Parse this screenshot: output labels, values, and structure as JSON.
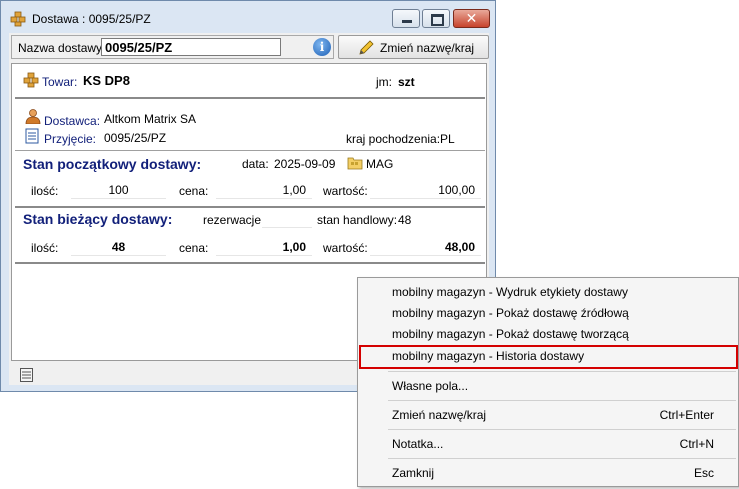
{
  "window": {
    "title": "Dostawa : 0095/25/PZ",
    "close_glyph": "✕"
  },
  "namebar": {
    "label": "Nazwa dostawy:",
    "value": "0095/25/PZ",
    "info_glyph": "i",
    "rename_button": "Zmień nazwę/kraj"
  },
  "product": {
    "label": "Towar:",
    "value": "KS DP8",
    "unit_label": "jm:",
    "unit_value": "szt"
  },
  "supplier": {
    "label": "Dostawca:",
    "value": "Altkom Matrix SA"
  },
  "receipt": {
    "label": "Przyjęcie:",
    "value": "0095/25/PZ",
    "country_label": "kraj pochodzenia:",
    "country_value": "PL"
  },
  "initial_state": {
    "header": "Stan początkowy dostawy:",
    "date_label": "data:",
    "date_value": "2025-09-09",
    "warehouse": "MAG",
    "qty_label": "ilość:",
    "qty_value": "100",
    "price_label": "cena:",
    "price_value": "1,00",
    "value_label": "wartość:",
    "value_value": "100,00"
  },
  "current_state": {
    "header": "Stan bieżący dostawy:",
    "reservations_label": "rezerwacje:",
    "reservations_value": "",
    "trade_label": "stan handlowy:",
    "trade_value": "48",
    "qty_label": "ilość:",
    "qty_value": "48",
    "price_label": "cena:",
    "price_value": "1,00",
    "value_label": "wartość:",
    "value_value": "48,00"
  },
  "context_menu": {
    "items": [
      {
        "label": "mobilny magazyn - Wydruk etykiety dostawy",
        "shortcut": ""
      },
      {
        "label": "mobilny magazyn - Pokaż dostawę źródłową",
        "shortcut": ""
      },
      {
        "label": "mobilny magazyn - Pokaż dostawę tworzącą",
        "shortcut": ""
      },
      {
        "label": "mobilny magazyn - Historia dostawy",
        "shortcut": "",
        "highlighted": true
      },
      {
        "label": "Własne pola...",
        "shortcut": ""
      },
      {
        "label": "Zmień nazwę/kraj",
        "shortcut": "Ctrl+Enter"
      },
      {
        "label": "Notatka...",
        "shortcut": "Ctrl+N"
      },
      {
        "label": "Zamknij",
        "shortcut": "Esc"
      }
    ]
  },
  "colors": {
    "header_text": "#12207a",
    "highlight_border": "#d40000",
    "window_frame": "#dbe6f3"
  },
  "icons": [
    "boxes-icon",
    "info-icon",
    "pencil-icon",
    "person-icon",
    "document-icon",
    "folder-icon",
    "note-icon"
  ]
}
